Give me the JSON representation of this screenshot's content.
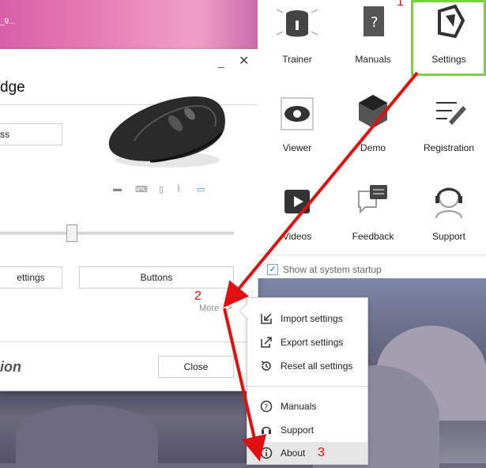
{
  "desktop": {
    "icon_text": "_9..."
  },
  "window": {
    "title_partial": "dge",
    "minimize": "_",
    "close_x": "✕",
    "device_select": "ss",
    "buttons": {
      "settings": "ettings",
      "buttons": "Buttons",
      "close": "Close"
    },
    "more_label": "More",
    "brand_partial": "ion"
  },
  "panel": {
    "tiles": [
      {
        "label": "Trainer",
        "icon": "trainer-icon"
      },
      {
        "label": "Manuals",
        "icon": "manuals-icon"
      },
      {
        "label": "Settings",
        "icon": "settings-icon",
        "selected": true
      },
      {
        "label": "Viewer",
        "icon": "viewer-icon"
      },
      {
        "label": "Demo",
        "icon": "demo-icon"
      },
      {
        "label": "Registration",
        "icon": "registration-icon"
      },
      {
        "label": "Videos",
        "icon": "videos-icon"
      },
      {
        "label": "Feedback",
        "icon": "feedback-icon"
      },
      {
        "label": "Support",
        "icon": "support-icon"
      }
    ],
    "startup_label": "Show at system startup",
    "startup_checked": true
  },
  "menu": {
    "items": [
      {
        "label": "Import settings",
        "icon": "import-icon"
      },
      {
        "label": "Export settings",
        "icon": "export-icon"
      },
      {
        "label": "Reset all settings",
        "icon": "reset-icon"
      },
      {
        "label": "Manuals",
        "icon": "help-icon"
      },
      {
        "label": "Support",
        "icon": "headset-icon"
      },
      {
        "label": "About",
        "icon": "info-icon"
      }
    ]
  },
  "annotations": {
    "step1": "1",
    "step2": "2",
    "step3": "3",
    "color": "#e01010"
  },
  "colors": {
    "selected_outline": "#7bd141",
    "accent": "#1e73c8"
  }
}
